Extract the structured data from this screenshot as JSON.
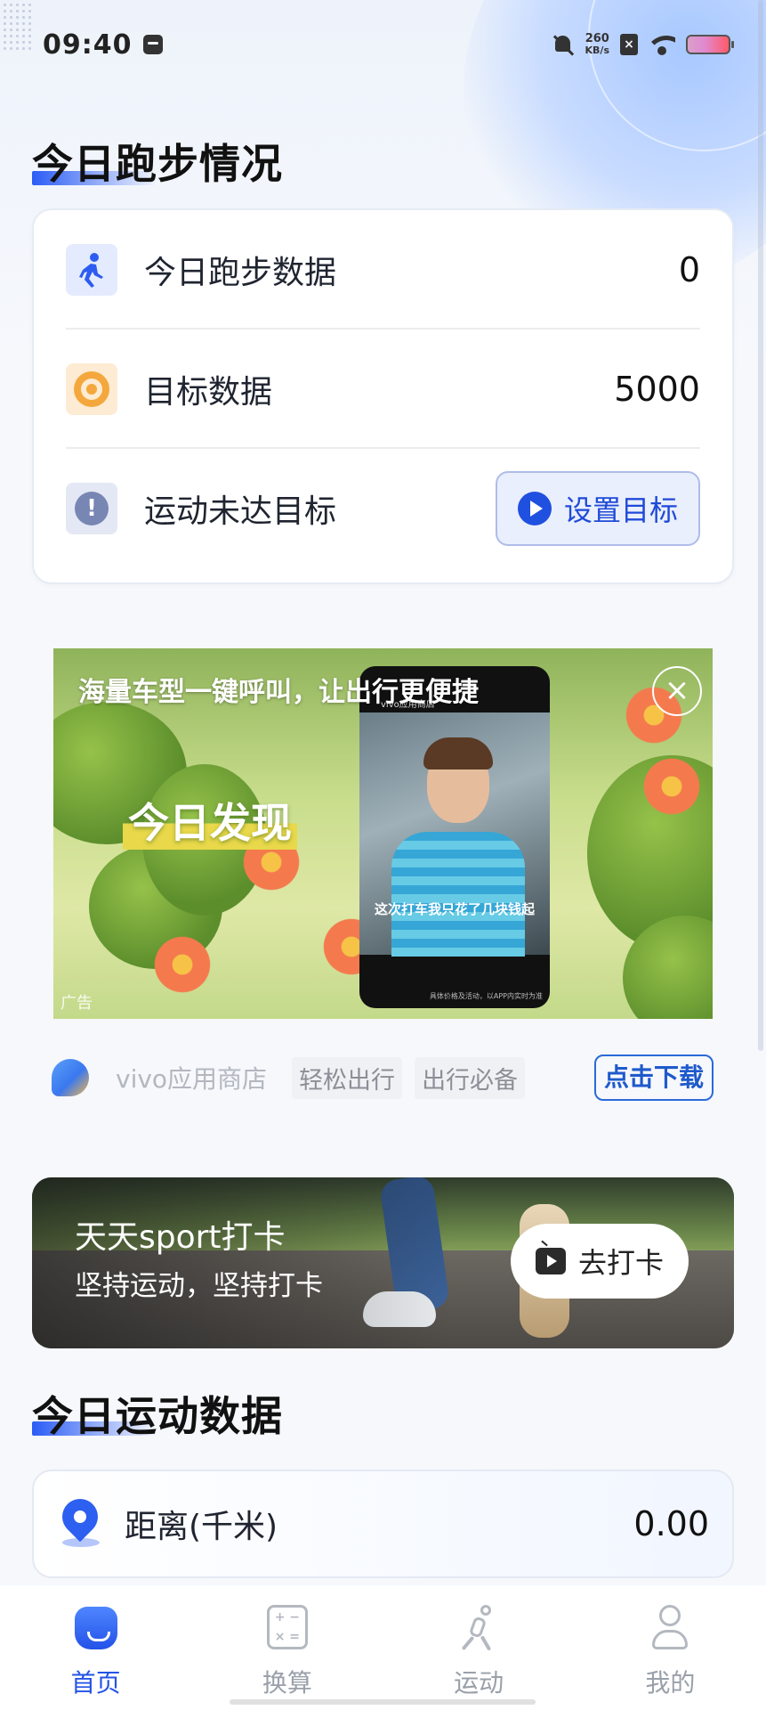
{
  "status_bar": {
    "time": "09:40",
    "net_speed_value": "260",
    "net_speed_unit": "KB/s"
  },
  "running_section": {
    "title": "今日跑步情况",
    "rows": [
      {
        "icon": "runner-icon",
        "label": "今日跑步数据",
        "value": "0"
      },
      {
        "icon": "target-icon",
        "label": "目标数据",
        "value": "5000"
      },
      {
        "icon": "alert-icon",
        "label": "运动未达目标",
        "button_label": "设置目标"
      }
    ]
  },
  "ad": {
    "headline": "海量车型一键呼叫，让出行更便捷",
    "discover_text": "今日发现",
    "video_caption": "这次打车我只花了几块钱起",
    "ad_tag": "广告",
    "source_name": "vivo应用商店",
    "tags": [
      "轻松出行",
      "出行必备"
    ],
    "download_label": "点击下载"
  },
  "checkin": {
    "title": "天天sport打卡",
    "subtitle": "坚持运动，坚持打卡",
    "button_label": "去打卡"
  },
  "sport_section": {
    "title": "今日运动数据",
    "distance_label": "距离(千米)",
    "distance_value": "0.00"
  },
  "tab_bar": {
    "tabs": [
      {
        "label": "首页",
        "icon": "home-icon",
        "active": true
      },
      {
        "label": "换算",
        "icon": "calculator-icon",
        "active": false
      },
      {
        "label": "运动",
        "icon": "runner-icon",
        "active": false
      },
      {
        "label": "我的",
        "icon": "profile-icon",
        "active": false
      }
    ]
  },
  "colors": {
    "accent": "#2453e6",
    "target_orange": "#f4a73c",
    "background": "#f6f8fc"
  }
}
